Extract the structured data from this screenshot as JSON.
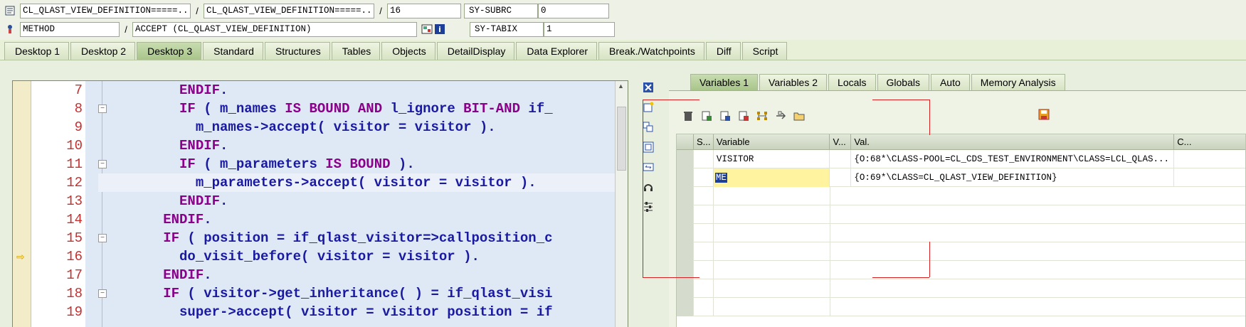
{
  "header": {
    "row1": {
      "program1": "CL_QLAST_VIEW_DEFINITION=====...",
      "program2": "CL_QLAST_VIEW_DEFINITION=====...",
      "line": "16",
      "sys_label": "SY-SUBRC",
      "sys_value": "0"
    },
    "row2": {
      "type": "METHOD",
      "name": "ACCEPT (CL_QLAST_VIEW_DEFINITION)",
      "sys_label": "SY-TABIX",
      "sys_value": "1"
    },
    "sep": "/"
  },
  "tabs": [
    "Desktop 1",
    "Desktop 2",
    "Desktop 3",
    "Standard",
    "Structures",
    "Tables",
    "Objects",
    "DetailDisplay",
    "Data Explorer",
    "Break./Watchpoints",
    "Diff",
    "Script"
  ],
  "editor": {
    "lines": [
      {
        "n": "7",
        "code": "          ENDIF."
      },
      {
        "n": "8",
        "code": "          IF ( m_names IS BOUND AND l_ignore BIT-AND if_"
      },
      {
        "n": "9",
        "code": "            m_names->accept( visitor = visitor )."
      },
      {
        "n": "10",
        "code": "          ENDIF."
      },
      {
        "n": "11",
        "code": "          IF ( m_parameters IS BOUND )."
      },
      {
        "n": "12",
        "code": "            m_parameters->accept( visitor = visitor )."
      },
      {
        "n": "13",
        "code": "          ENDIF."
      },
      {
        "n": "14",
        "code": "        ENDIF."
      },
      {
        "n": "15",
        "code": "        IF ( position = if_qlast_visitor=>callposition_c"
      },
      {
        "n": "16",
        "code": "          do_visit_before( visitor = visitor )."
      },
      {
        "n": "17",
        "code": "        ENDIF."
      },
      {
        "n": "18",
        "code": "        IF ( visitor->get_inheritance( ) = if_qlast_visi"
      },
      {
        "n": "19",
        "code": "          super->accept( visitor = visitor position = if"
      }
    ]
  },
  "right_tabs": [
    "Variables 1",
    "Variables 2",
    "Locals",
    "Globals",
    "Auto",
    "Memory Analysis"
  ],
  "grid": {
    "headers": [
      "S...",
      "Variable",
      "V...",
      "Val.",
      "C..."
    ],
    "rows": [
      {
        "var": "VISITOR",
        "val": "{O:68*\\CLASS-POOL=CL_CDS_TEST_ENVIRONMENT\\CLASS=LCL_QLAS..."
      },
      {
        "var": "ME",
        "val": "{O:69*\\CLASS=CL_QLAST_VIEW_DEFINITION}"
      }
    ]
  }
}
